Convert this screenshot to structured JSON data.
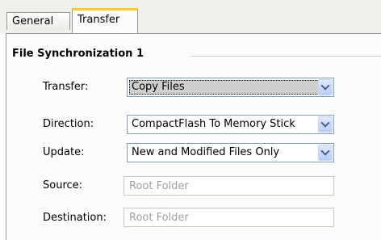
{
  "tabs": [
    {
      "label": "General"
    },
    {
      "label": "Transfer"
    }
  ],
  "group": {
    "title": "File Synchronization 1"
  },
  "fields": {
    "transfer": {
      "label": "Transfer:",
      "value": "Copy Files"
    },
    "direction": {
      "label": "Direction:",
      "value": "CompactFlash To Memory Stick"
    },
    "update": {
      "label": "Update:",
      "value": "New and Modified Files Only"
    },
    "source": {
      "label": "Source:",
      "placeholder": "Root Folder"
    },
    "destination": {
      "label": "Destination:",
      "placeholder": "Root Folder"
    }
  },
  "icons": {
    "dropdown": "chevron-down-icon"
  }
}
